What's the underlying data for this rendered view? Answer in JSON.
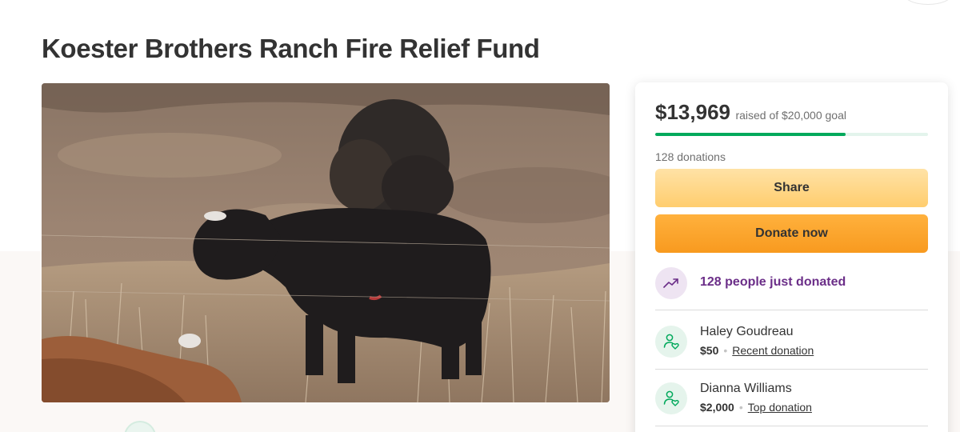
{
  "campaign": {
    "title": "Koester Brothers Ranch Fire Relief Fund"
  },
  "progress": {
    "raised": "$13,969",
    "goal_label": "raised of $20,000 goal",
    "fraction": 0.6985,
    "donations_count": "128 donations",
    "bar_color": "#02a95c",
    "track_color": "#e3f4ec"
  },
  "actions": {
    "share_label": "Share",
    "donate_label": "Donate now"
  },
  "activity": {
    "icon": "trending-up-icon",
    "text": "128 people just donated",
    "color": "#6b2e88"
  },
  "donors": [
    {
      "name": "Haley Goudreau",
      "amount": "$50",
      "tag": "Recent donation",
      "icon": "donor-heart-icon"
    },
    {
      "name": "Dianna Williams",
      "amount": "$2,000",
      "tag": "Top donation",
      "icon": "donor-heart-icon"
    }
  ],
  "colors": {
    "accent_green": "#02a95c",
    "share_button": "#ffcd6e",
    "donate_button": "#f89a1f"
  }
}
